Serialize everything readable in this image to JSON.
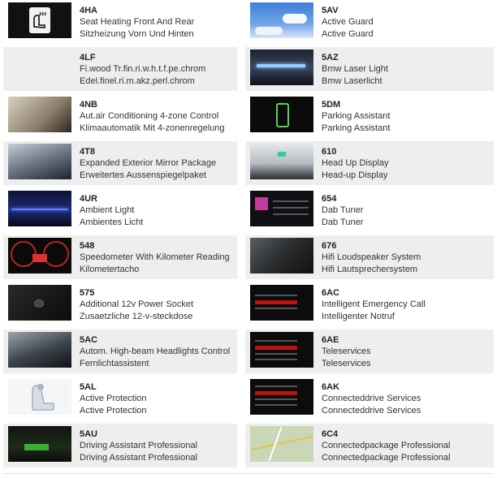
{
  "left_column": [
    {
      "code": "4HA",
      "en": "Seat Heating Front And Rear",
      "de": "Sitzheizung Vorn Und Hinten",
      "icon": "seat-heating-icon"
    },
    {
      "code": "4LF",
      "en": "Fi.wood Tr.fin.ri.w.h.t.f.pe.chrom",
      "de": "Edel.finel.ri.m.akz.perl.chrom",
      "icon": ""
    },
    {
      "code": "4NB",
      "en": "Aut.air Conditioning 4-zone Control",
      "de": "Klimaautomatik Mit 4-zonenregelung",
      "icon": "climate-control-photo"
    },
    {
      "code": "4T8",
      "en": "Expanded Exterior Mirror Package",
      "de": "Erweitertes Aussenspiegelpaket",
      "icon": "mirror-photo"
    },
    {
      "code": "4UR",
      "en": "Ambient Light",
      "de": "Ambientes Licht",
      "icon": "ambient-light-photo"
    },
    {
      "code": "548",
      "en": "Speedometer With Kilometer Reading",
      "de": "Kilometertacho",
      "icon": "speedometer-photo"
    },
    {
      "code": "575",
      "en": "Additional 12v Power Socket",
      "de": "Zusaetzliche 12-v-steckdose",
      "icon": "power-socket-photo"
    },
    {
      "code": "5AC",
      "en": "Autom. High-beam Headlights Control",
      "de": "Fernlichtassistent",
      "icon": "headlight-photo"
    },
    {
      "code": "5AL",
      "en": "Active Protection",
      "de": "Active Protection",
      "icon": "active-protection-photo"
    },
    {
      "code": "5AU",
      "en": "Driving Assistant Professional",
      "de": "Driving Assistant Professional",
      "icon": "driving-assistant-photo"
    }
  ],
  "right_column": [
    {
      "code": "5AV",
      "en": "Active Guard",
      "de": "Active Guard",
      "icon": "sky-photo"
    },
    {
      "code": "5AZ",
      "en": "Bmw Laser Light",
      "de": "Bmw Laserlicht",
      "icon": "laser-light-photo"
    },
    {
      "code": "5DM",
      "en": "Parking Assistant",
      "de": "Parking Assistant",
      "icon": "parking-assistant-photo"
    },
    {
      "code": "610",
      "en": "Head Up Display",
      "de": "Head-up Display",
      "icon": "head-up-display-photo"
    },
    {
      "code": "654",
      "en": "Dab Tuner",
      "de": "Dab Tuner",
      "icon": "dab-tuner-photo"
    },
    {
      "code": "676",
      "en": "Hifi Loudspeaker System",
      "de": "Hifi Lautsprechersystem",
      "icon": "hifi-speaker-photo"
    },
    {
      "code": "6AC",
      "en": "Intelligent Emergency Call",
      "de": "Intelligenter Notruf",
      "icon": "emergency-call-photo"
    },
    {
      "code": "6AE",
      "en": "Teleservices",
      "de": "Teleservices",
      "icon": "teleservices-photo"
    },
    {
      "code": "6AK",
      "en": "Connecteddrive Services",
      "de": "Connecteddrive Services",
      "icon": "connecteddrive-photo"
    },
    {
      "code": "6C4",
      "en": "Connectedpackage Professional",
      "de": "Connectedpackage Professional",
      "icon": "map-navigation-photo"
    }
  ]
}
